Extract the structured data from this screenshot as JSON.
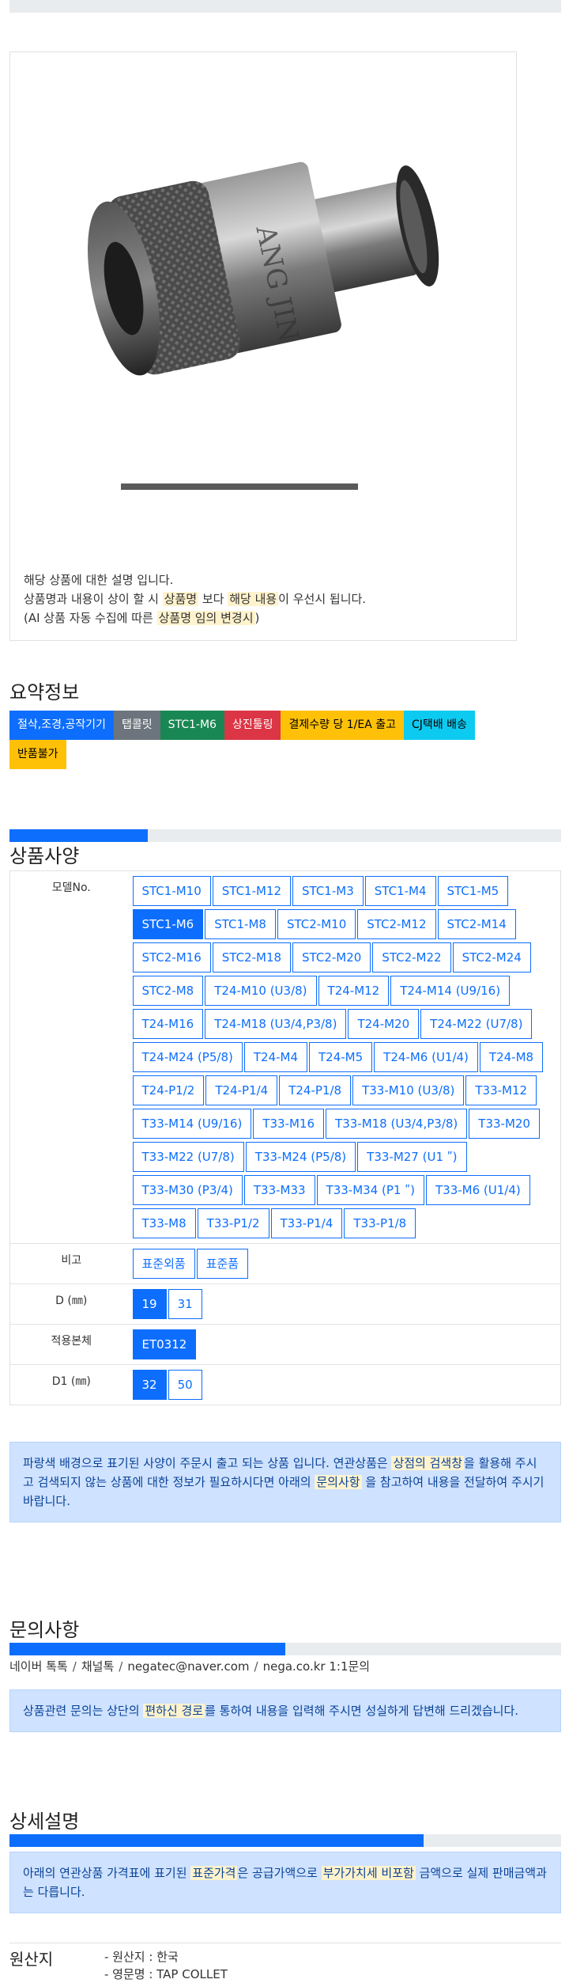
{
  "product": {
    "image_alt": "태핑 콜렛 제품 사진",
    "description_lines": [
      {
        "parts": [
          {
            "t": "해당 상품에 대한 설명 입니다.",
            "hl": false
          }
        ]
      },
      {
        "parts": [
          {
            "t": "상품명과 내용이 상이 할 시 ",
            "hl": false
          },
          {
            "t": "상품명",
            "hl": true
          },
          {
            "t": " 보다 ",
            "hl": false
          },
          {
            "t": "해당 내용",
            "hl": true
          },
          {
            "t": "이 우선시 됩니다.",
            "hl": false
          }
        ]
      },
      {
        "parts": [
          {
            "t": "(AI 상품 자동 수집에 따른 ",
            "hl": false
          },
          {
            "t": "상품명 임의 변경시",
            "hl": true
          },
          {
            "t": ")",
            "hl": false
          }
        ]
      }
    ]
  },
  "summary": {
    "title": "요약정보",
    "badges": [
      {
        "label": "절삭,조경,공작기기",
        "color": "blue"
      },
      {
        "label": "탭콜릿",
        "color": "gray"
      },
      {
        "label": "STC1-M6",
        "color": "green"
      },
      {
        "label": "상진툴링",
        "color": "red"
      },
      {
        "label": "결제수량 당 1/EA 출고",
        "color": "yellow"
      },
      {
        "label": "CJ택배 배송",
        "color": "cyan"
      },
      {
        "label": "반품불가",
        "color": "yellow"
      }
    ]
  },
  "spec": {
    "title": "상품사양",
    "progress": 0.25,
    "rows": [
      {
        "label": "모델No.",
        "options": [
          "STC1-M10",
          "STC1-M12",
          "STC1-M3",
          "STC1-M4",
          "STC1-M5",
          "STC1-M6",
          "STC1-M8",
          "STC2-M10",
          "STC2-M12",
          "STC2-M14",
          "STC2-M16",
          "STC2-M18",
          "STC2-M20",
          "STC2-M22",
          "STC2-M24",
          "STC2-M8",
          "T24-M10 (U3/8)",
          "T24-M12",
          "T24-M14 (U9/16)",
          "T24-M16",
          "T24-M18 (U3/4,P3/8)",
          "T24-M20",
          "T24-M22 (U7/8)",
          "T24-M24 (P5/8)",
          "T24-M4",
          "T24-M5",
          "T24-M6 (U1/4)",
          "T24-M8",
          "T24-P1/2",
          "T24-P1/4",
          "T24-P1/8",
          "T33-M10 (U3/8)",
          "T33-M12",
          "T33-M14 (U9/16)",
          "T33-M16",
          "T33-M18 (U3/4,P3/8)",
          "T33-M20",
          "T33-M22 (U7/8)",
          "T33-M24 (P5/8)",
          "T33-M27 (U1 ʺ)",
          "T33-M30 (P3/4)",
          "T33-M33",
          "T33-M34 (P1 ʺ)",
          "T33-M6 (U1/4)",
          "T33-M8",
          "T33-P1/2",
          "T33-P1/4",
          "T33-P1/8"
        ],
        "active": "STC1-M6"
      },
      {
        "label": "비고",
        "options": [
          "표준외품",
          "표준품"
        ],
        "active": ""
      },
      {
        "label": "D (㎜)",
        "options": [
          "19",
          "31"
        ],
        "active": "19"
      },
      {
        "label": "적용본체",
        "options": [
          "ET0312"
        ],
        "active": "ET0312"
      },
      {
        "label": "D1 (㎜)",
        "options": [
          "32",
          "50"
        ],
        "active": "32"
      }
    ],
    "notice": [
      {
        "t": "파랑색 배경으로 표기된 사양이 주문시 출고 되는 상품 입니다. 연관상품은 ",
        "hl": false
      },
      {
        "t": "상점의 검색창",
        "hl": true
      },
      {
        "t": "을 활용해 주시고 검색되지 않는 상품에 대한 정보가 필요하시다면 아래의 ",
        "hl": false
      },
      {
        "t": "문의사항",
        "hl": true
      },
      {
        "t": " 을 참고하여 내용을 전달하여 주시기 바랍니다.",
        "hl": false
      }
    ]
  },
  "inquiry": {
    "title": "문의사항",
    "progress": 0.5,
    "links": [
      "네이버 톡톡",
      "채널톡",
      "negatec@naver.com",
      "nega.co.kr 1:1문의"
    ],
    "notice": [
      {
        "t": "상품관련 문의는 상단의 ",
        "hl": false
      },
      {
        "t": "편하신 경로",
        "hl": true
      },
      {
        "t": "를 통하여 내용을 입력해 주시면 성실하게 답변해 드리겠습니다.",
        "hl": false
      }
    ]
  },
  "detail": {
    "title": "상세설명",
    "progress": 0.75,
    "notice": [
      {
        "t": "아래의 연관상품 가격표에 표기된 ",
        "hl": false
      },
      {
        "t": "표준가격",
        "hl": true
      },
      {
        "t": "은 공급가액으로 ",
        "hl": false
      },
      {
        "t": "부가가치세 비포함",
        "hl": true
      },
      {
        "t": " 금액으로 실제 판매금액과는 다릅니다.",
        "hl": false
      }
    ]
  },
  "origin": {
    "label": "원산지",
    "lines": [
      "- 원산지 : 한국",
      "- 영문명 : TAP COLLET"
    ]
  }
}
